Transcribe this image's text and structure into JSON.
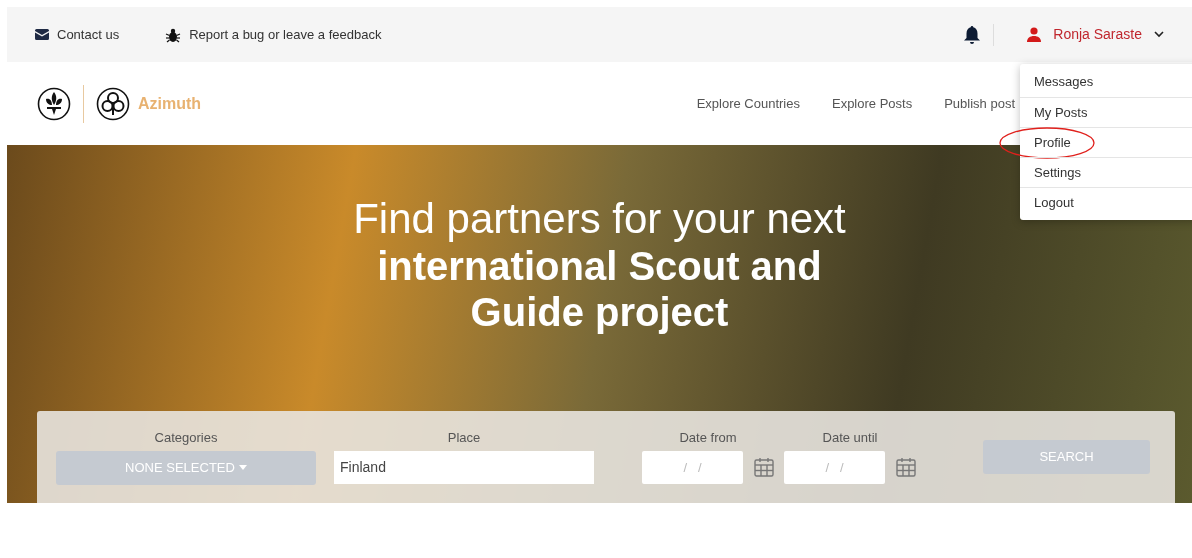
{
  "top_bar": {
    "links": [
      {
        "kind": "mail",
        "label": "Contact us"
      },
      {
        "kind": "bug",
        "label": "Report a bug or leave a feedback"
      }
    ],
    "user": {
      "name": "Ronja Saraste"
    }
  },
  "brand": {
    "name": "Azimuth"
  },
  "nav": {
    "items": [
      "Explore Countries",
      "Explore Posts",
      "Publish post"
    ]
  },
  "user_menu": {
    "expanded": true,
    "items": [
      {
        "label": "Messages",
        "circled": false
      },
      {
        "label": "My Posts",
        "circled": false
      },
      {
        "label": "Profile",
        "circled": true
      },
      {
        "label": "Settings",
        "circled": false
      },
      {
        "label": "Logout",
        "circled": false
      }
    ]
  },
  "hero": {
    "title_line": "Find partners for your next",
    "title_bold": "international Scout and Guide project"
  },
  "search": {
    "categories": {
      "label": "Categories",
      "value": "NONE SELECTED"
    },
    "place": {
      "label": "Place",
      "value": "Finland"
    },
    "date_from": {
      "label": "Date from",
      "placeholder": "/   /"
    },
    "date_until": {
      "label": "Date until",
      "placeholder": "/   /"
    },
    "button": "SEARCH"
  }
}
